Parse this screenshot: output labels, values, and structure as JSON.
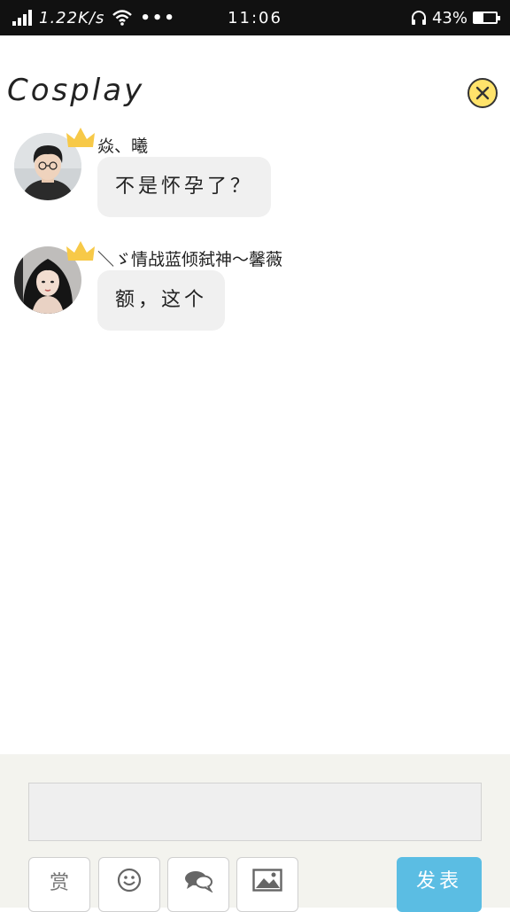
{
  "status_bar": {
    "speed": "1.22K/s",
    "dots": "•••",
    "time": "11:06",
    "battery": "43%",
    "battery_level": 0.43
  },
  "header": {
    "title": "Cosplay"
  },
  "messages": [
    {
      "sender": "焱、曦",
      "text": "不是怀孕了？"
    },
    {
      "sender": "＼ゞ情战蓝倾弑神～馨薇",
      "text": "额，这个"
    }
  ],
  "footer": {
    "input_placeholder": "",
    "reward_label": "赏",
    "send_label": "发表"
  },
  "colors": {
    "status_bar_bg": "#111111",
    "footer_bg": "#f3f3ee",
    "bubble_bg": "#f0f0f0",
    "send_button": "#5bbde3",
    "close_button": "#ffe36b",
    "crown": "#f7c948"
  },
  "icons": [
    "signal-icon",
    "wifi-icon",
    "headphone-icon",
    "battery-icon",
    "close-icon",
    "crown-icon",
    "emoji-icon",
    "chat-icon",
    "image-icon"
  ]
}
